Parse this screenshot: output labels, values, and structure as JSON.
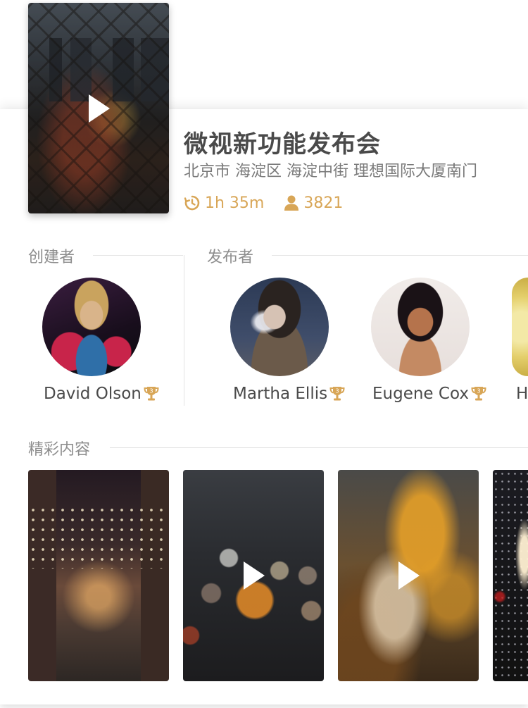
{
  "event": {
    "title": "微视新功能发布会",
    "address": "北京市 海淀区 海淀中街 理想国际大厦南门",
    "duration": "1h 35m",
    "attendees": "3821"
  },
  "sections": {
    "creator_label": "创建者",
    "publisher_label": "发布者",
    "highlights_label": "精彩内容"
  },
  "creator": {
    "name": "David Olson"
  },
  "publishers": [
    {
      "name": "Martha Ellis"
    },
    {
      "name": "Eugene Cox"
    },
    {
      "name": "H"
    }
  ],
  "icons": {
    "duration": "history-clock-icon",
    "attendees": "user-icon",
    "badge": "trophy-icon",
    "play": "play-icon"
  },
  "colors": {
    "accent": "#d8a657",
    "title": "#4a4a4a",
    "secondary": "#8e8e8e"
  }
}
